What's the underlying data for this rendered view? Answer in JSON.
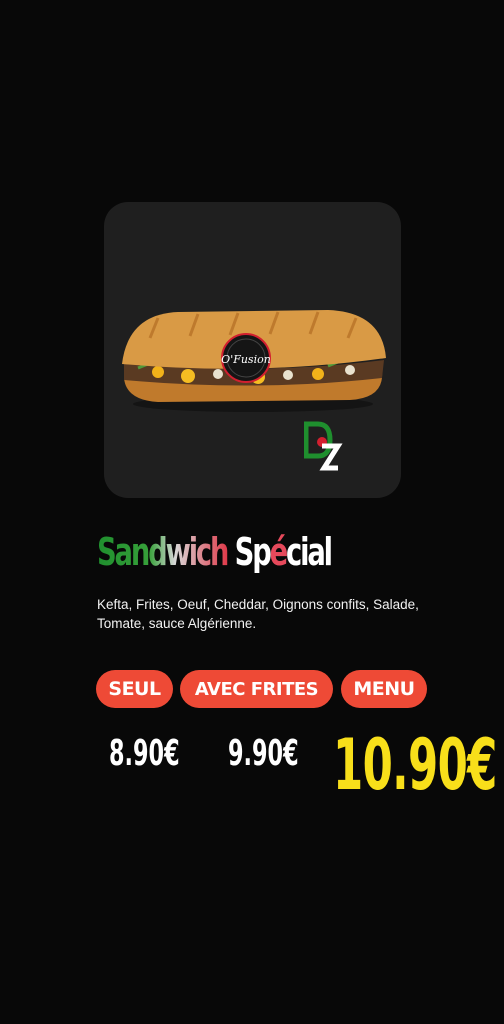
{
  "product": {
    "title_part1": "Sandwich",
    "title_part2_prefix": "Sp",
    "title_part2_accent": "é",
    "title_part2_suffix": "cial",
    "description": "Kefta, Frites, Oeuf, Cheddar, Oignons confits, Salade, Tomate, sauce Algérienne.",
    "logo_text": "O'Fusion",
    "badge_text": "DZ"
  },
  "options": [
    {
      "label": "SEUL",
      "price": "8.90€"
    },
    {
      "label": "AVEC FRITES",
      "price": "9.90€"
    },
    {
      "label": "MENU",
      "price": "10.90€"
    }
  ],
  "colors": {
    "background": "#080808",
    "card": "#1f1f1f",
    "pill": "#ee4a36",
    "highlight_price": "#f8df1a",
    "green": "#1f8f2e",
    "red": "#e03a4a"
  },
  "icons": {
    "dz": "algeria-dz-icon",
    "logo": "ofusion-logo-icon"
  }
}
